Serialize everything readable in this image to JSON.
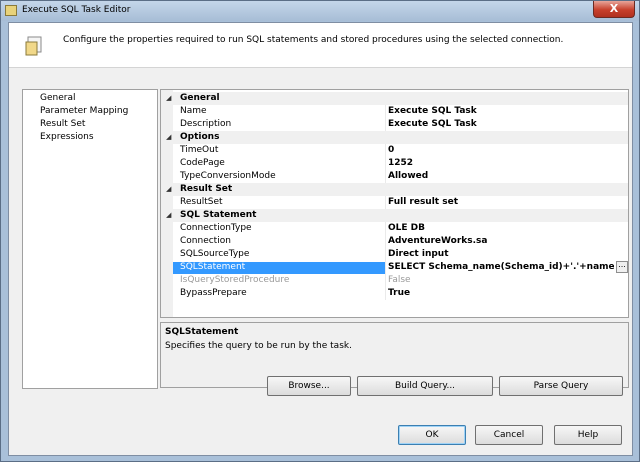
{
  "window": {
    "title": "Execute SQL Task Editor",
    "close_label": "X"
  },
  "header": {
    "text": "Configure the properties required to run SQL statements and stored procedures using the selected connection."
  },
  "nav": {
    "items": [
      {
        "label": "General"
      },
      {
        "label": "Parameter Mapping"
      },
      {
        "label": "Result Set"
      },
      {
        "label": "Expressions"
      }
    ]
  },
  "grid": {
    "rows": [
      {
        "kind": "category",
        "label": "General"
      },
      {
        "kind": "prop",
        "label": "Name",
        "value": "Execute SQL Task"
      },
      {
        "kind": "prop",
        "label": "Description",
        "value": "Execute SQL Task"
      },
      {
        "kind": "category",
        "label": "Options"
      },
      {
        "kind": "prop",
        "label": "TimeOut",
        "value": "0"
      },
      {
        "kind": "prop",
        "label": "CodePage",
        "value": "1252"
      },
      {
        "kind": "prop",
        "label": "TypeConversionMode",
        "value": "Allowed"
      },
      {
        "kind": "category",
        "label": "Result Set"
      },
      {
        "kind": "prop",
        "label": "ResultSet",
        "value": "Full result set"
      },
      {
        "kind": "category",
        "label": "SQL Statement"
      },
      {
        "kind": "prop",
        "label": "ConnectionType",
        "value": "OLE DB"
      },
      {
        "kind": "prop",
        "label": "Connection",
        "value": "AdventureWorks.sa"
      },
      {
        "kind": "prop",
        "label": "SQLSourceType",
        "value": "Direct input"
      },
      {
        "kind": "prop",
        "label": "SQLStatement",
        "value": "SELECT Schema_name(Schema_id)+'.'+name TableName",
        "selected": true,
        "ellipsis": "..."
      },
      {
        "kind": "prop",
        "label": "IsQueryStoredProcedure",
        "value": "False",
        "disabled": true
      },
      {
        "kind": "prop",
        "label": "BypassPrepare",
        "value": "True"
      }
    ]
  },
  "description": {
    "title": "SQLStatement",
    "text": "Specifies the query to be run by the task."
  },
  "buttons": {
    "browse": "Browse...",
    "build_query": "Build Query...",
    "parse_query": "Parse Query",
    "ok": "OK",
    "cancel": "Cancel",
    "help": "Help"
  },
  "colors": {
    "selection": "#3399ff",
    "titlebar": "#a9c0d9"
  }
}
